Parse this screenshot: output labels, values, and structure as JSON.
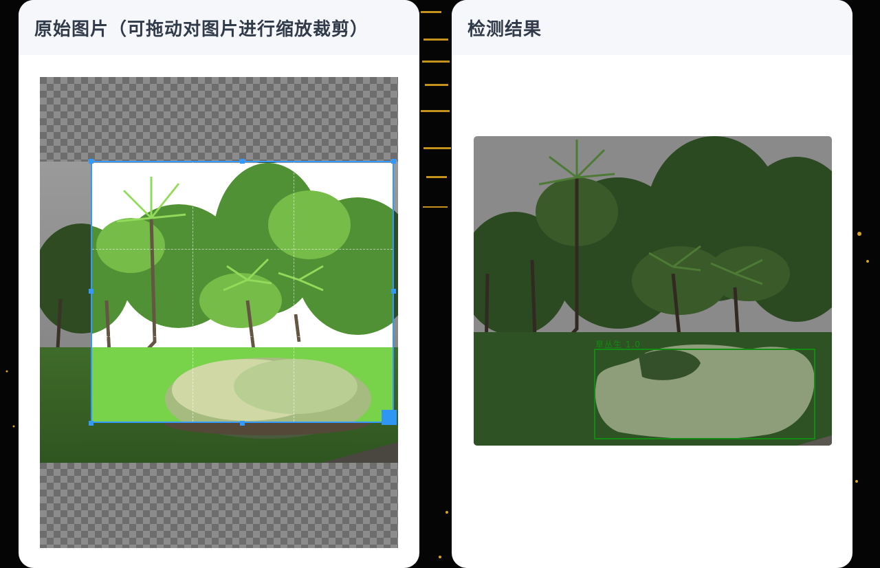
{
  "left_panel": {
    "title": "原始图片（可拖动对图片进行缩放裁剪）"
  },
  "right_panel": {
    "title": "检测结果",
    "detection_label": "草丛生 1.0",
    "box_color": "#138a13"
  },
  "icons": [
    "resize-handle-icon"
  ],
  "colors": {
    "accent": "#3399ff",
    "card_header_bg": "#f5f7fa",
    "page_bg": "#050505"
  }
}
